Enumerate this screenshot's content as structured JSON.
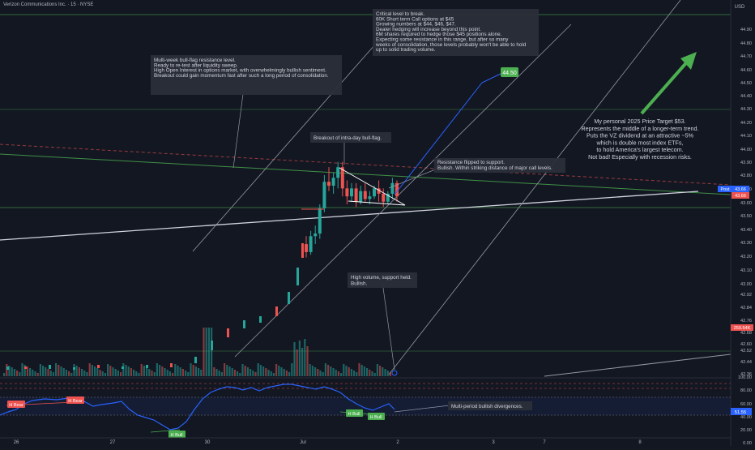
{
  "header": {
    "symbol_title": "Verizon Communications Inc. · 15 · NYSE"
  },
  "price_axis": {
    "currency": "USD",
    "ticks": [
      "44.90",
      "44.80",
      "44.70",
      "44.60",
      "44.50",
      "44.40",
      "44.30",
      "44.20",
      "44.10",
      "44.00",
      "43.90",
      "43.80",
      "43.70",
      "43.60",
      "43.50",
      "43.40",
      "43.30",
      "43.20",
      "43.10",
      "43.00",
      "42.92",
      "42.84",
      "42.76",
      "42.68",
      "42.60",
      "42.52",
      "42.44",
      "42.36"
    ],
    "post_label": "Post",
    "post_price": "43.66",
    "last_price": "43.66",
    "volume_label": "259.54K"
  },
  "time_axis": {
    "ticks": [
      "26",
      "27",
      "30",
      "Jul",
      "2",
      "3",
      "7",
      "8"
    ]
  },
  "rsi": {
    "ticks": [
      "100.00",
      "80.00",
      "60.00",
      "40.00",
      "20.00",
      "0.00"
    ],
    "current_value": "51.55"
  },
  "annotations": {
    "critical": [
      "Critical level to break.",
      "60K Short term Call options at $45",
      "Growing numbers at $44, $46, $47.",
      "Dealer hedging will increase beyond this point.",
      "6M shares required to hedge those $45 positions alone.",
      "",
      "Expecting some resistance in this range, but after so many",
      "weeks of consolidation, those levels probably won't be able to hold",
      "up to solid trading volume."
    ],
    "multiweek": [
      "Multi-week bull-flag resistance level.",
      "",
      "Ready to re-test after liquidity sweep.",
      "",
      "High Open Interest in options market, with overwhelmingly bullish sentiment.",
      "",
      "Breakout could gain momentum fast after such a long period of consolidation."
    ],
    "intraday": "Breakout of intra-day bull-flag.",
    "resistance": [
      "Resistance flipped to support.",
      "Bullish. Within striking distance of major call levels."
    ],
    "volume": [
      "High volume, support held.",
      "Bullish."
    ],
    "target": [
      "My personal 2025 Price Target $53.",
      "Represents the middle of a longer-term trend.",
      "",
      "Puts the VZ dividend at an attractive ~5%",
      "which is double most index ETFs,",
      "to hold America's largest telecom.",
      "Not bad! Especially with recession risks."
    ],
    "divergence": "Multi-period bullish divergences.",
    "target_badge": "44.50"
  },
  "rsi_labels": {
    "bear": "H Bear",
    "bull": "H Bull"
  },
  "colors": {
    "background": "#131722",
    "up": "#26a69a",
    "down": "#ef5350",
    "rsi_line": "#2962ff",
    "arrow": "#4caf50",
    "post_badge": "#2962ff"
  },
  "chart_data": {
    "type": "candlestick",
    "y_axis_range": [
      42.36,
      44.95
    ],
    "rsi_range": [
      0,
      100
    ],
    "candles": [
      {
        "x": "Jul 1",
        "o": 43.28,
        "h": 43.34,
        "c": 43.22,
        "l": 43.18
      },
      {
        "x": "Jul 1",
        "o": 43.22,
        "h": 43.38,
        "c": 43.34,
        "l": 43.2
      },
      {
        "x": "Jul 1",
        "o": 43.34,
        "h": 43.42,
        "c": 43.36,
        "l": 43.28
      },
      {
        "x": "Jul 1",
        "o": 43.36,
        "h": 43.58,
        "c": 43.55,
        "l": 43.32
      },
      {
        "x": "Jul 1",
        "o": 43.55,
        "h": 43.8,
        "c": 43.75,
        "l": 43.52
      },
      {
        "x": "Jul 1",
        "o": 43.75,
        "h": 43.86,
        "c": 43.72,
        "l": 43.68
      },
      {
        "x": "Jul 1",
        "o": 43.72,
        "h": 43.82,
        "c": 43.78,
        "l": 43.66
      },
      {
        "x": "Jul 1",
        "o": 43.78,
        "h": 43.9,
        "c": 43.86,
        "l": 43.7
      },
      {
        "x": "Jul 1",
        "o": 43.86,
        "h": 43.9,
        "c": 43.7,
        "l": 43.64
      },
      {
        "x": "Jul 1",
        "o": 43.7,
        "h": 43.76,
        "c": 43.64,
        "l": 43.58
      },
      {
        "x": "Jul 1",
        "o": 43.64,
        "h": 43.74,
        "c": 43.7,
        "l": 43.6
      },
      {
        "x": "Jul 1",
        "o": 43.7,
        "h": 43.74,
        "c": 43.6,
        "l": 43.56
      },
      {
        "x": "Jul 1",
        "o": 43.6,
        "h": 43.72,
        "c": 43.68,
        "l": 43.58
      },
      {
        "x": "Jul 1",
        "o": 43.68,
        "h": 43.74,
        "c": 43.62,
        "l": 43.6
      },
      {
        "x": "Jul 1",
        "o": 43.62,
        "h": 43.68,
        "c": 43.64,
        "l": 43.58
      },
      {
        "x": "Jul 1",
        "o": 43.64,
        "h": 43.72,
        "c": 43.7,
        "l": 43.62
      },
      {
        "x": "Jul 1",
        "o": 43.7,
        "h": 43.76,
        "c": 43.66,
        "l": 43.6
      },
      {
        "x": "Jul 1",
        "o": 43.66,
        "h": 43.7,
        "c": 43.6,
        "l": 43.56
      },
      {
        "x": "Jul 1",
        "o": 43.6,
        "h": 43.68,
        "c": 43.66,
        "l": 43.58
      },
      {
        "x": "Jul 2",
        "o": 43.66,
        "h": 43.78,
        "c": 43.74,
        "l": 43.62
      },
      {
        "x": "Jul 2",
        "o": 43.74,
        "h": 43.76,
        "c": 43.64,
        "l": 43.6
      }
    ]
  }
}
